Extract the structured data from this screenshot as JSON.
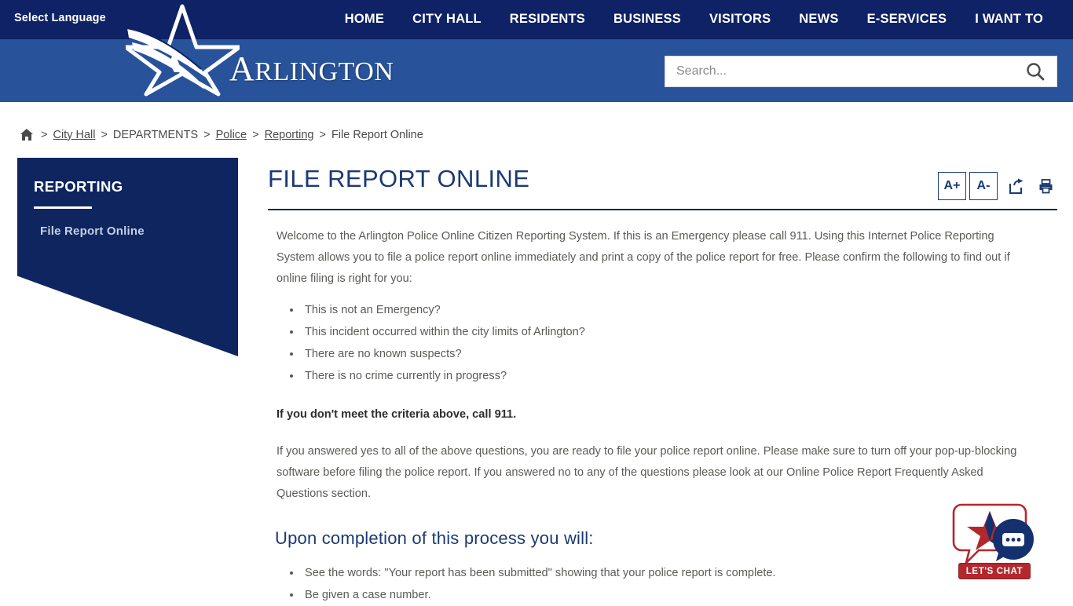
{
  "header": {
    "select_language": "Select Language",
    "logo_text": "Arlington",
    "nav": [
      {
        "label": "HOME"
      },
      {
        "label": "CITY HALL"
      },
      {
        "label": "RESIDENTS"
      },
      {
        "label": "BUSINESS"
      },
      {
        "label": "VISITORS"
      },
      {
        "label": "NEWS"
      },
      {
        "label": "E-SERVICES"
      },
      {
        "label": "I WANT TO"
      }
    ],
    "search": {
      "placeholder": "Search...",
      "value": "",
      "icon": "search-icon"
    },
    "colors": {
      "topbar": "#0e2265",
      "lowerbar": "#28539b"
    }
  },
  "breadcrumb": {
    "home_icon": "home-icon",
    "separator": ">",
    "items": [
      {
        "label": "City Hall",
        "link": true
      },
      {
        "label": "DEPARTMENTS",
        "link": false
      },
      {
        "label": "Police",
        "link": true
      },
      {
        "label": "Reporting",
        "link": true
      },
      {
        "label": "File Report Online",
        "link": false
      }
    ]
  },
  "sidebar": {
    "title": "REPORTING",
    "items": [
      {
        "label": "File Report Online"
      }
    ],
    "color": "#0e2560"
  },
  "main": {
    "title": "FILE REPORT ONLINE",
    "actions": {
      "font_increase": "A+",
      "font_decrease": "A-",
      "share_icon": "share-icon",
      "print_icon": "print-icon"
    },
    "intro_paragraph": "Welcome to the Arlington Police Online Citizen Reporting System. If this is an Emergency please call 911. Using this Internet Police Reporting System allows you to file a police report online immediately and print a copy of the police report for free. Please confirm the following to find out if online filing is right for you:",
    "criteria": [
      "This is not an Emergency?",
      "This incident occurred within the city limits of Arlington?",
      "There are no known suspects?",
      "There is no crime currently in progress?"
    ],
    "warning": "If you don't meet the criteria above, call 911.",
    "instructions_paragraph": "If you answered yes to all of the above questions, you are ready to file your police report online. Please make sure to turn off your pop-up-blocking software before filing the police report. If you answered no to any of the questions please look at our Online Police Report Frequently Asked Questions section.",
    "completion_heading": "Upon completion of this process you will:",
    "completion_items": [
      "See the words: \"Your report has been submitted\" showing that your police report is complete.",
      "Be given a case number."
    ]
  },
  "chat_widget": {
    "label": "LET'S CHAT",
    "colors": {
      "red": "#b3282d",
      "navy": "#15306e"
    }
  }
}
